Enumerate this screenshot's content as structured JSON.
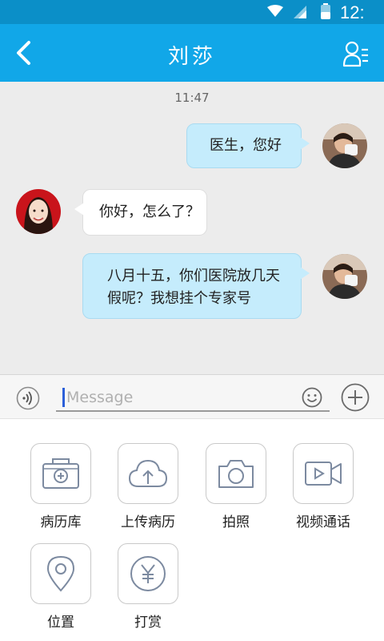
{
  "status_bar": {
    "time": "12:"
  },
  "header": {
    "title": "刘莎"
  },
  "chat": {
    "timestamp": "11:47",
    "messages": [
      {
        "direction": "outgoing",
        "lines": [
          "医生，您好"
        ]
      },
      {
        "direction": "incoming",
        "lines": [
          "你好，怎么了？"
        ]
      },
      {
        "direction": "outgoing",
        "lines": [
          "八月十五，你们医院放几天",
          "假呢？我想挂个专家号"
        ]
      }
    ]
  },
  "composer": {
    "placeholder": "Message",
    "value": ""
  },
  "panel": {
    "items": [
      {
        "label": "病历库",
        "icon": "medical-record-library-icon"
      },
      {
        "label": "上传病历",
        "icon": "cloud-upload-icon"
      },
      {
        "label": "拍照",
        "icon": "camera-icon"
      },
      {
        "label": "视频通话",
        "icon": "video-call-icon"
      },
      {
        "label": "位置",
        "icon": "location-pin-icon"
      },
      {
        "label": "打赏",
        "icon": "yuan-reward-icon"
      }
    ]
  },
  "colors": {
    "header": "#11a7e8",
    "status_bar": "#0b8fc8",
    "outgoing_bubble": "#c5ecfc",
    "chat_background": "#ececec"
  }
}
